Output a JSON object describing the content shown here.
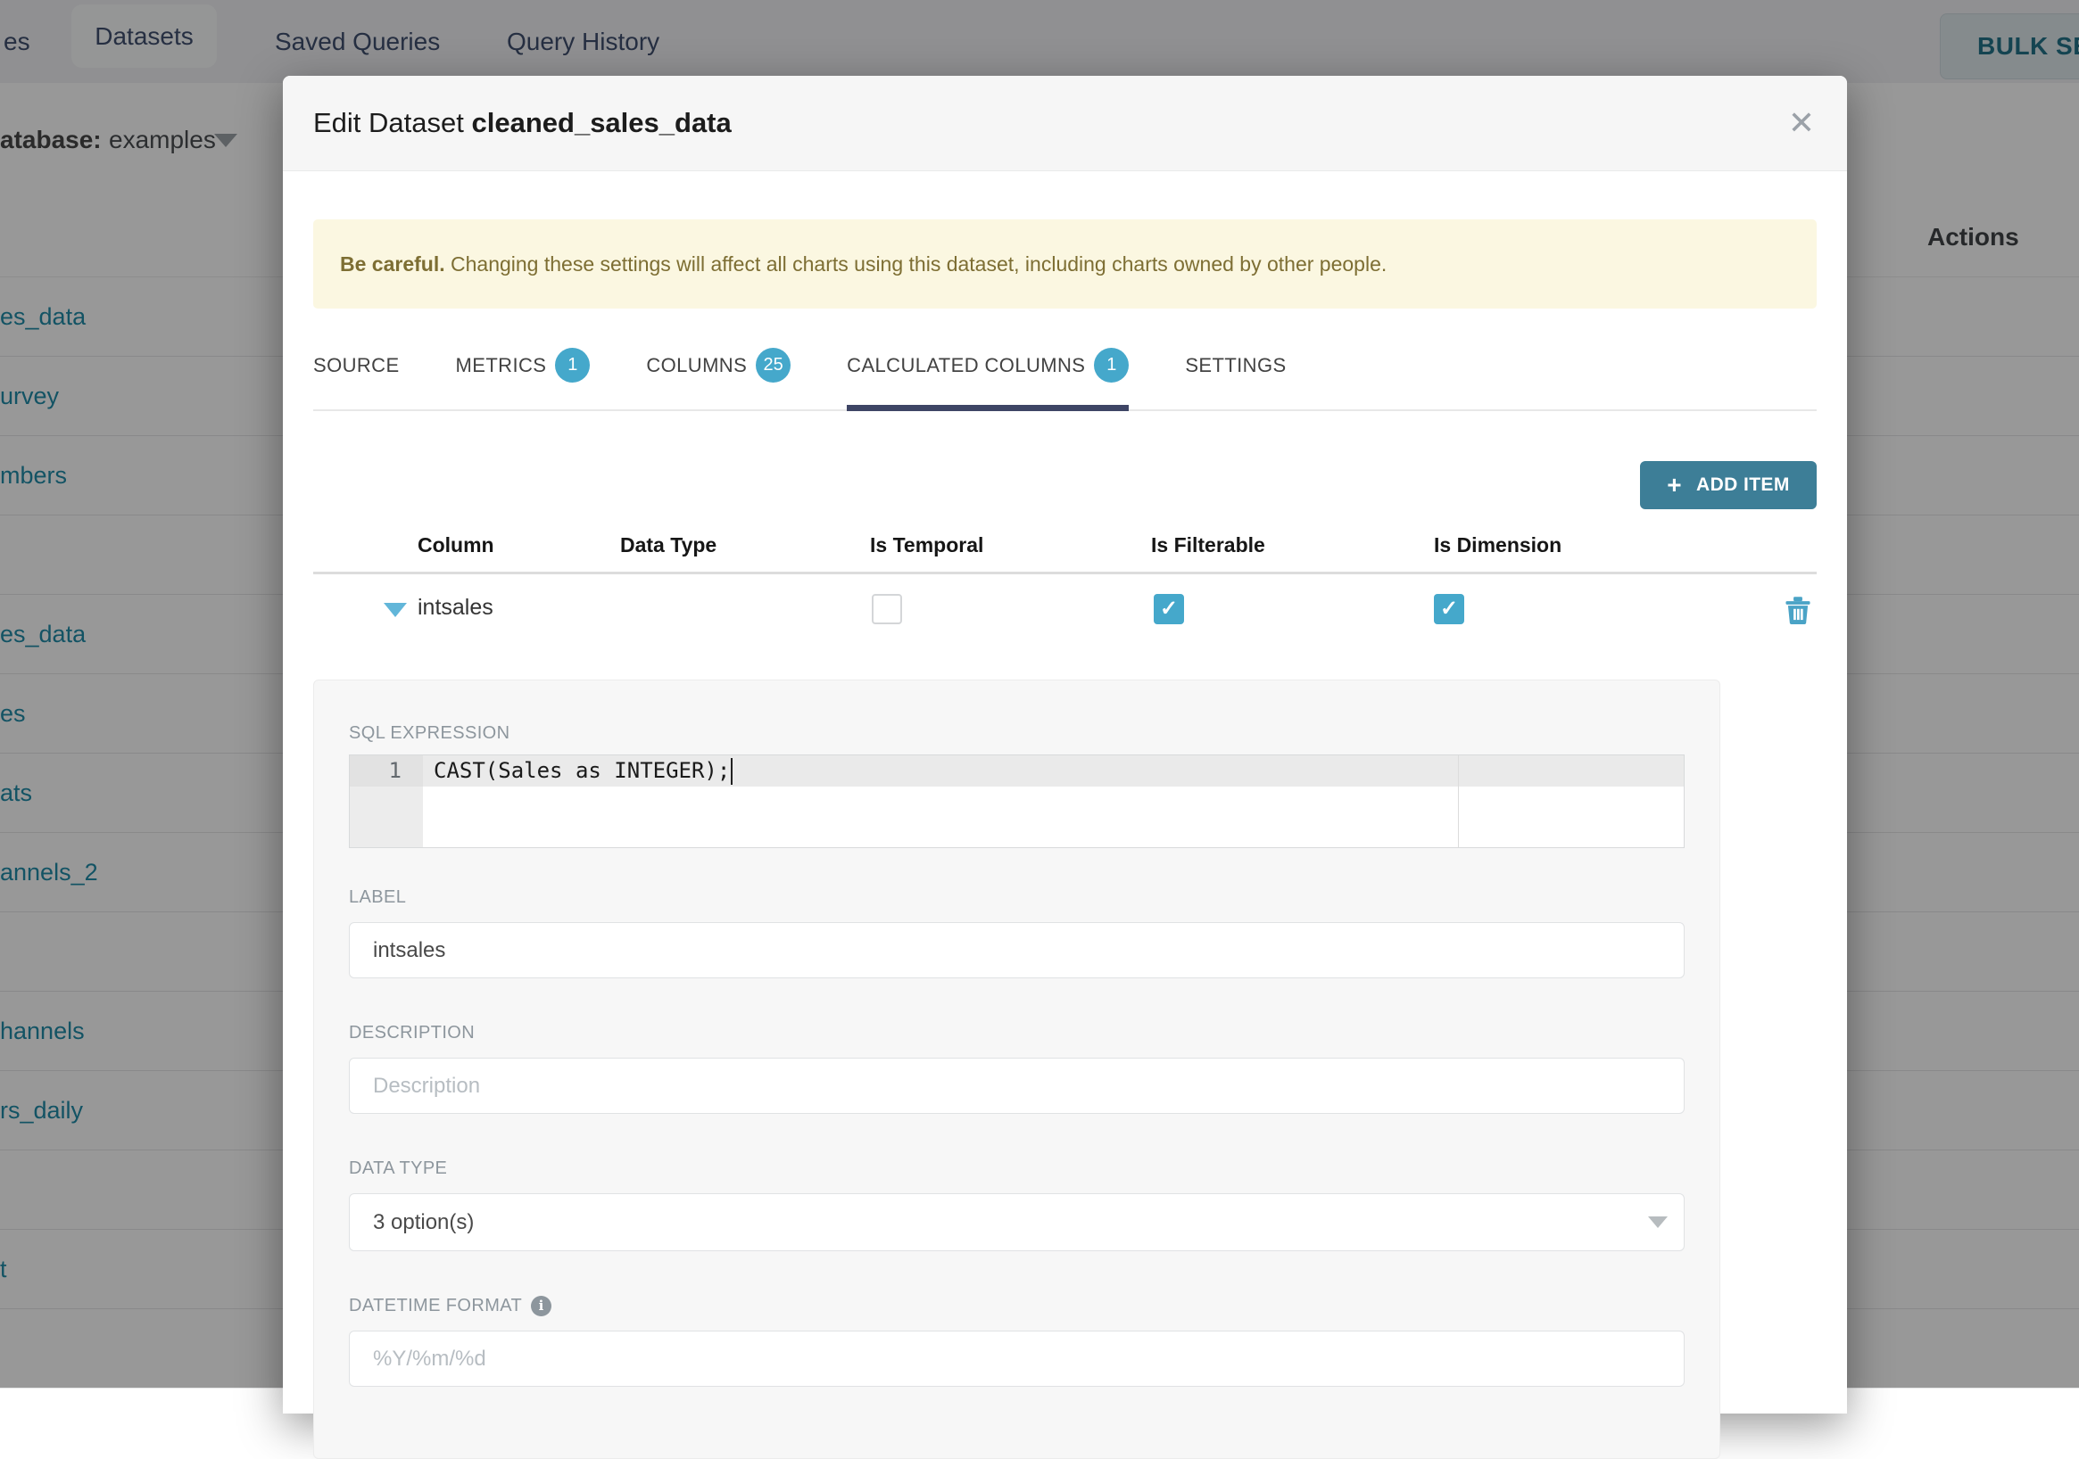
{
  "background": {
    "nav": {
      "partial_tab_label": "es",
      "active_tab": "Datasets",
      "saved_queries": "Saved Queries",
      "query_history": "Query History",
      "bulk_select_button": "BULK SELECT"
    },
    "filter_bar": {
      "label": "atabase:",
      "value": "examples"
    },
    "table": {
      "actions_header": "Actions",
      "rows": [
        "es_data",
        "urvey",
        "mbers",
        "",
        "es_data",
        "es",
        "ats",
        "annels_2",
        "",
        "hannels",
        "rs_daily",
        "",
        "t",
        ""
      ]
    }
  },
  "modal": {
    "title_prefix": "Edit Dataset",
    "title_name": "cleaned_sales_data",
    "icons": {
      "close": "✕",
      "plus": "+",
      "check": "✓",
      "info": "i"
    },
    "warning": {
      "bold": "Be careful.",
      "text": " Changing these settings will affect all charts using this dataset, including charts owned by other people."
    },
    "tabs": [
      {
        "label": "SOURCE"
      },
      {
        "label": "METRICS",
        "badge": "1"
      },
      {
        "label": "COLUMNS",
        "badge": "25"
      },
      {
        "label": "CALCULATED COLUMNS",
        "badge": "1",
        "active": true
      },
      {
        "label": "SETTINGS"
      }
    ],
    "add_item_label": "ADD ITEM",
    "columns_table": {
      "headers": [
        "Column",
        "Data Type",
        "Is Temporal",
        "Is Filterable",
        "Is Dimension"
      ],
      "row": {
        "name": "intsales",
        "is_temporal": false,
        "is_filterable": true,
        "is_dimension": true
      }
    },
    "panel": {
      "sql_label": "SQL EXPRESSION",
      "sql_line_number": "1",
      "sql_code": "CAST(Sales as INTEGER);",
      "label_label": "LABEL",
      "label_value": "intsales",
      "description_label": "DESCRIPTION",
      "description_placeholder": "Description",
      "datatype_label": "DATA TYPE",
      "datatype_value": "3 option(s)",
      "datetime_label": "DATETIME FORMAT",
      "datetime_placeholder": "%Y/%m/%d"
    },
    "colors": {
      "accent": "#45a8cb",
      "add_item": "#3d7e97",
      "tab_indicator": "#3e4565",
      "warning_bg": "#fbf7e1"
    }
  }
}
